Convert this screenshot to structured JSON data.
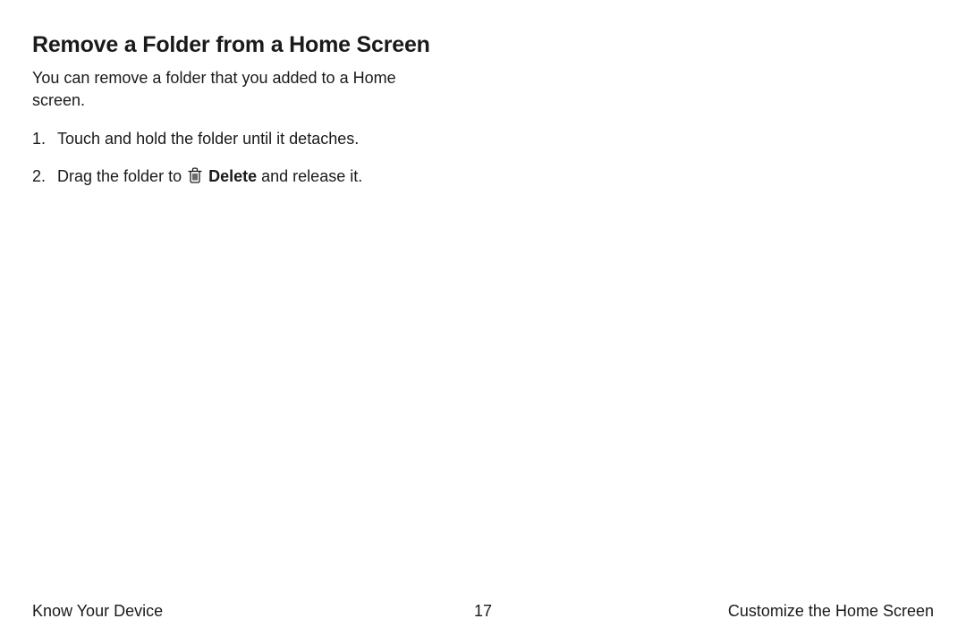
{
  "heading": "Remove a Folder from a Home Screen",
  "intro": "You can remove a folder that you added to a Home screen.",
  "steps": [
    {
      "text": "Touch and hold the folder until it detaches."
    },
    {
      "pre": "Drag the folder to ",
      "bold": "Delete",
      "post": " and release it."
    }
  ],
  "footer": {
    "left": "Know Your Device",
    "page": "17",
    "right": "Customize the Home Screen"
  }
}
